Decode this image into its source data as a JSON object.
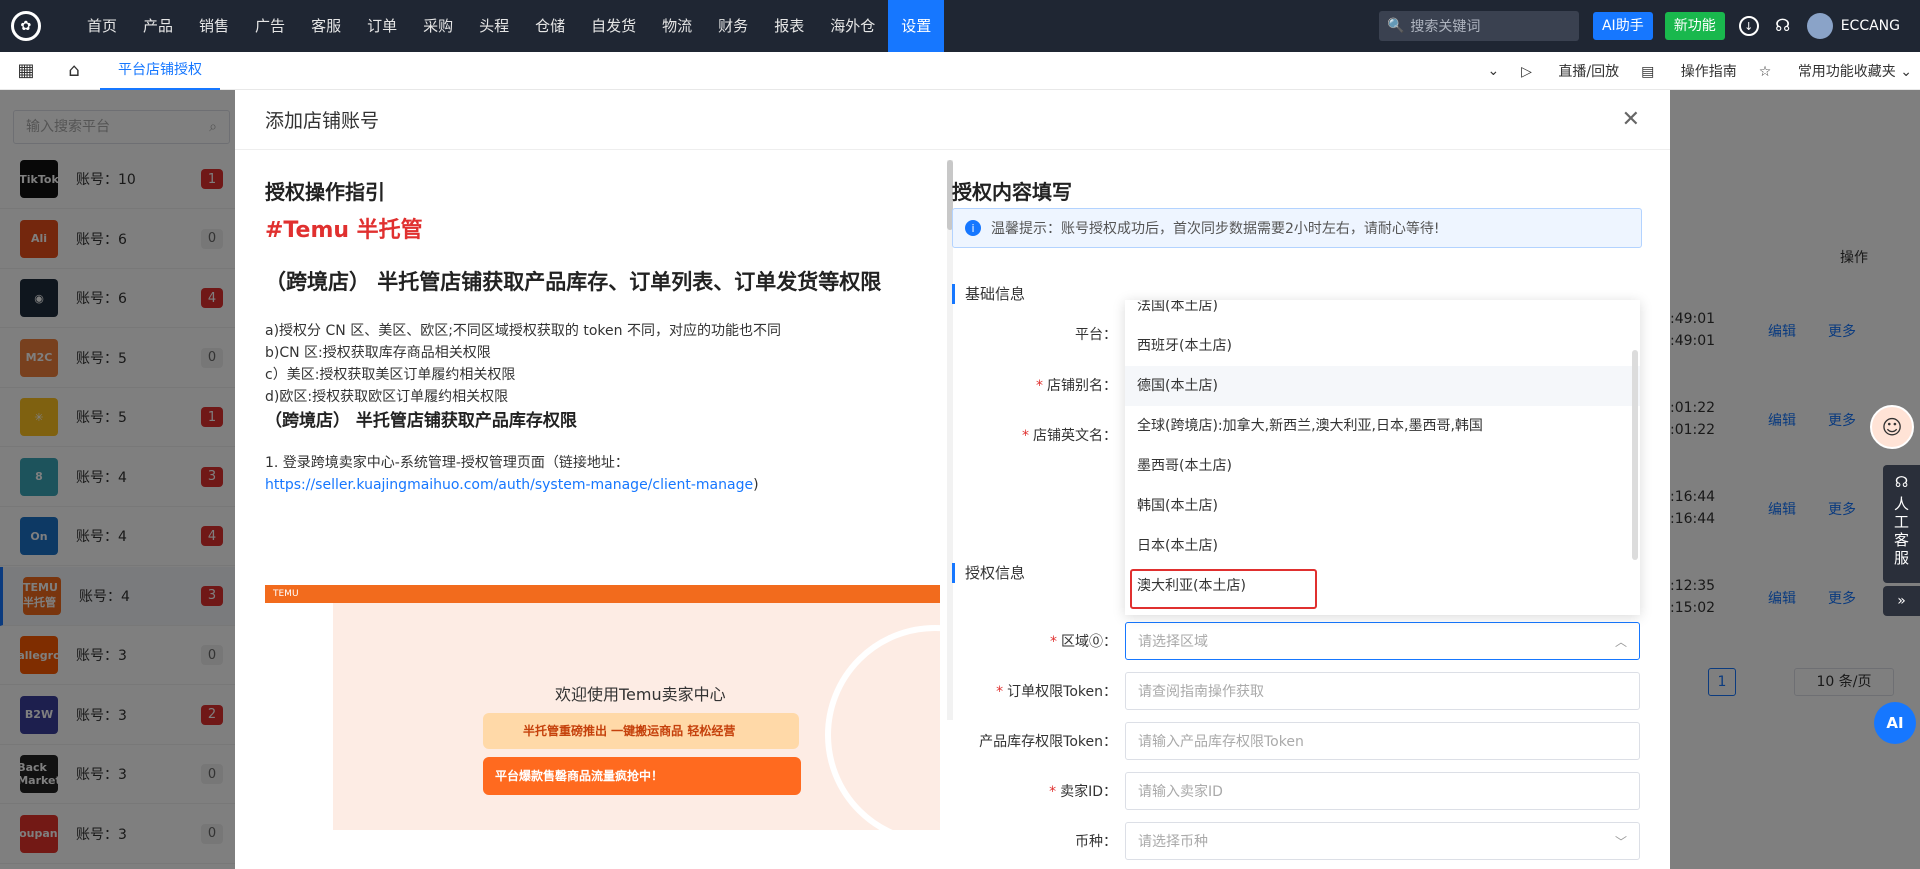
{
  "topbar": {
    "logo": "✿",
    "nav": [
      "首页",
      "产品",
      "销售",
      "广告",
      "客服",
      "订单",
      "采购",
      "头程",
      "仓储",
      "自发货",
      "物流",
      "财务",
      "报表",
      "海外仓",
      "设置"
    ],
    "active_index": 14,
    "search_placeholder": "搜索关键词",
    "ai_button": "AI助手",
    "new_button": "新功能",
    "user": "ECCANG"
  },
  "subbar": {
    "tab": "平台店铺授权",
    "live": "直播/回放",
    "guide": "操作指南",
    "favorites": "常用功能收藏夹"
  },
  "sidebar": {
    "search_placeholder": "输入搜索平台",
    "platforms": [
      {
        "logo": "TikTok",
        "account": "账号：10",
        "count": "1",
        "red": true,
        "color": "#111"
      },
      {
        "logo": "Ali",
        "account": "账号：6",
        "count": "0",
        "red": false,
        "color": "#e94e1b"
      },
      {
        "logo": "◉",
        "account": "账号：6",
        "count": "4",
        "red": true,
        "color": "#1f2d3d"
      },
      {
        "logo": "M2C",
        "account": "账号：5",
        "count": "0",
        "red": false,
        "color": "#f0803c"
      },
      {
        "logo": "✳",
        "account": "账号：5",
        "count": "1",
        "red": true,
        "color": "#ffc220"
      },
      {
        "logo": "8",
        "account": "账号：4",
        "count": "3",
        "red": true,
        "color": "#3aa6b9"
      },
      {
        "logo": "On",
        "account": "账号：4",
        "count": "4",
        "red": true,
        "color": "#1a73c9"
      },
      {
        "logo": "TEMU 半托管",
        "account": "账号：4",
        "count": "3",
        "red": true,
        "color": "#f26b1d"
      },
      {
        "logo": "allegro",
        "account": "账号：3",
        "count": "0",
        "red": false,
        "color": "#ff5a00"
      },
      {
        "logo": "B2W",
        "account": "账号：3",
        "count": "2",
        "red": true,
        "color": "#3b3f9c"
      },
      {
        "logo": "Back Market",
        "account": "账号：3",
        "count": "0",
        "red": false,
        "color": "#222"
      },
      {
        "logo": "coupang",
        "account": "账号：3",
        "count": "0",
        "red": false,
        "color": "#e6332a"
      }
    ]
  },
  "background": {
    "col_header": "操作",
    "times": [
      ":49:01",
      ":49:01",
      ":01:22",
      ":01:22",
      ":16:44",
      ":16:44",
      ":12:35",
      ":15:02"
    ],
    "edit": "编辑",
    "more": "更多",
    "page": "1",
    "page_size": "10 条/页"
  },
  "modal": {
    "title": "添加店铺账号",
    "close": "✕",
    "guide_title": "授权操作指引",
    "temu_title": "#Temu 半托管",
    "big_title": "（跨境店） 半托管店铺获取产品库存、订单列表、订单发货等权限",
    "lines": [
      "a)授权分 CN 区、美区、欧区;不同区域授权获取的 token 不同，对应的功能也不同",
      "b)CN 区:授权获取库存商品相关权限",
      "c）美区:授权获取美区订单履约相关权限",
      "d)欧区:授权获取欧区订单履约相关权限"
    ],
    "sub_title": "（跨境店） 半托管店铺获取产品库存权限",
    "step1": "1. 登录跨境卖家中心-系统管理-授权管理页面（链接地址：",
    "link": "https://seller.kuajingmaihuo.com/auth/system-manage/client-manage",
    "link_tail": ")",
    "shot_welcome": "欢迎使用Temu卖家中心",
    "shot_banner1": "半托管重磅推出 一键搬运商品 轻松经营",
    "shot_banner2": "平台爆款售罄商品流量疯抢中！",
    "fill_title": "授权内容填写",
    "notice": "温馨提示：账号授权成功后，首次同步数据需要2小时左右，请耐心等待!",
    "basic_title": "基础信息",
    "auth_title": "授权信息",
    "fields": {
      "platform": "平台：",
      "alias": "店铺别名：",
      "en_name": "店铺英文名：",
      "region": "区域⓪：",
      "region_ph": "请选择区域",
      "order_token": "订单权限Token：",
      "order_token_ph": "请查阅指南操作获取",
      "stock_token": "产品库存权限Token：",
      "stock_token_ph": "请输入产品库存权限Token",
      "seller_id": "卖家ID：",
      "seller_id_ph": "请输入卖家ID",
      "currency": "币种：",
      "currency_ph": "请选择币种"
    },
    "dropdown": [
      "法国(本土店)",
      "西班牙(本土店)",
      "德国(本土店)",
      "全球(跨境店):加拿大,新西兰,澳大利亚,日本,墨西哥,韩国",
      "墨西哥(本土店)",
      "韩国(本土店)",
      "日本(本土店)",
      "澳大利亚(本土店)"
    ]
  },
  "float": {
    "service": "人工客服",
    "ai": "AI"
  }
}
